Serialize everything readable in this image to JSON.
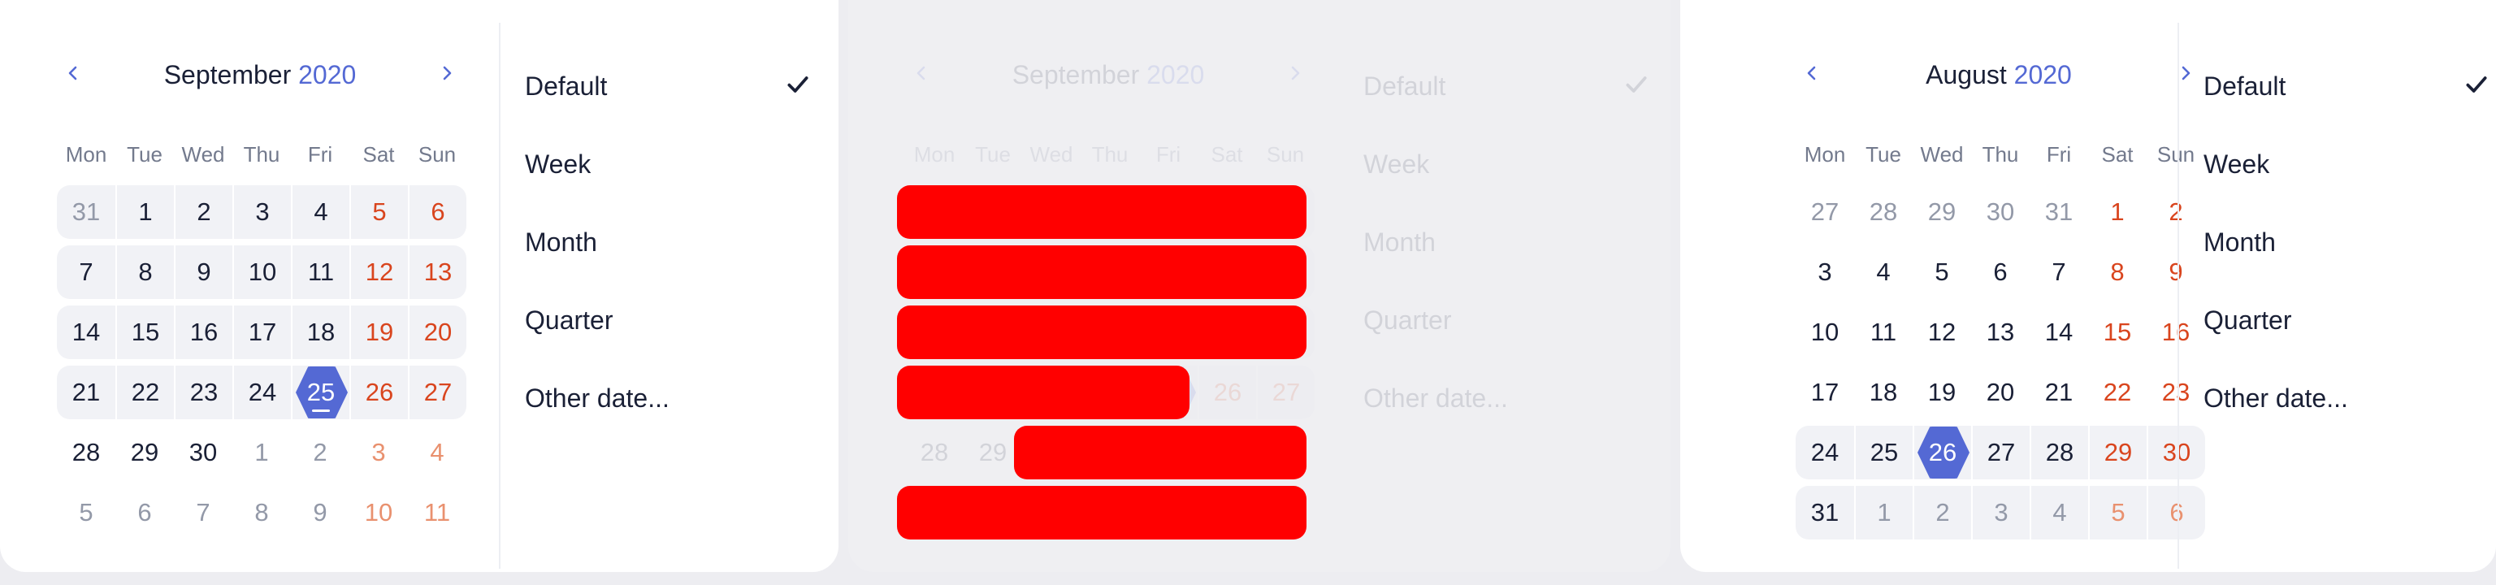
{
  "weekdays": [
    "Mon",
    "Tue",
    "Wed",
    "Thu",
    "Fri",
    "Sat",
    "Sun"
  ],
  "menu_items": [
    "Default",
    "Week",
    "Month",
    "Quarter",
    "Other date..."
  ],
  "checked_item": "Default",
  "icons": {
    "prev": "chevron-left-icon",
    "next": "chevron-right-icon",
    "check": "checkmark-icon"
  },
  "colors": {
    "accent": "#5469d4",
    "weekend": "#d9451e",
    "text": "#1a2036",
    "muted": "#9399a8",
    "highlight": "#f1f2f6",
    "error_overlay": "#ff0000"
  },
  "calendars": [
    {
      "month": "September",
      "year": "2020",
      "weeks": [
        [
          {
            "d": "31",
            "o": true
          },
          {
            "d": "1"
          },
          {
            "d": "2"
          },
          {
            "d": "3"
          },
          {
            "d": "4"
          },
          {
            "d": "5",
            "w": true
          },
          {
            "d": "6",
            "w": true
          }
        ],
        [
          {
            "d": "7"
          },
          {
            "d": "8"
          },
          {
            "d": "9"
          },
          {
            "d": "10"
          },
          {
            "d": "11"
          },
          {
            "d": "12",
            "w": true
          },
          {
            "d": "13",
            "w": true
          }
        ],
        [
          {
            "d": "14"
          },
          {
            "d": "15"
          },
          {
            "d": "16"
          },
          {
            "d": "17"
          },
          {
            "d": "18"
          },
          {
            "d": "19",
            "w": true
          },
          {
            "d": "20",
            "w": true
          }
        ],
        [
          {
            "d": "21"
          },
          {
            "d": "22"
          },
          {
            "d": "23"
          },
          {
            "d": "24"
          },
          {
            "d": "25",
            "s": true,
            "u": true
          },
          {
            "d": "26",
            "w": true
          },
          {
            "d": "27",
            "w": true
          }
        ],
        [
          {
            "d": "28"
          },
          {
            "d": "29"
          },
          {
            "d": "30"
          },
          {
            "d": "1",
            "o": true
          },
          {
            "d": "2",
            "o": true
          },
          {
            "d": "3",
            "o": true,
            "w": true
          },
          {
            "d": "4",
            "o": true,
            "w": true
          }
        ],
        [
          {
            "d": "5",
            "o": true
          },
          {
            "d": "6",
            "o": true
          },
          {
            "d": "7",
            "o": true
          },
          {
            "d": "8",
            "o": true
          },
          {
            "d": "9",
            "o": true
          },
          {
            "d": "10",
            "o": true,
            "w": true
          },
          {
            "d": "11",
            "o": true,
            "w": true
          }
        ]
      ],
      "highlighted_weeks": [
        0,
        1,
        2,
        3
      ]
    },
    {
      "month": "August",
      "year": "2020",
      "weeks": [
        [
          {
            "d": "27",
            "o": true
          },
          {
            "d": "28",
            "o": true
          },
          {
            "d": "29",
            "o": true
          },
          {
            "d": "30",
            "o": true
          },
          {
            "d": "31",
            "o": true
          },
          {
            "d": "1",
            "w": true
          },
          {
            "d": "2",
            "w": true
          }
        ],
        [
          {
            "d": "3"
          },
          {
            "d": "4"
          },
          {
            "d": "5"
          },
          {
            "d": "6"
          },
          {
            "d": "7"
          },
          {
            "d": "8",
            "w": true
          },
          {
            "d": "9",
            "w": true
          }
        ],
        [
          {
            "d": "10"
          },
          {
            "d": "11"
          },
          {
            "d": "12"
          },
          {
            "d": "13"
          },
          {
            "d": "14"
          },
          {
            "d": "15",
            "w": true
          },
          {
            "d": "16",
            "w": true
          }
        ],
        [
          {
            "d": "17"
          },
          {
            "d": "18"
          },
          {
            "d": "19"
          },
          {
            "d": "20"
          },
          {
            "d": "21"
          },
          {
            "d": "22",
            "w": true
          },
          {
            "d": "23",
            "w": true
          }
        ],
        [
          {
            "d": "24"
          },
          {
            "d": "25"
          },
          {
            "d": "26",
            "s": true
          },
          {
            "d": "27"
          },
          {
            "d": "28"
          },
          {
            "d": "29",
            "w": true
          },
          {
            "d": "30",
            "w": true
          }
        ],
        [
          {
            "d": "31"
          },
          {
            "d": "1",
            "o": true
          },
          {
            "d": "2",
            "o": true
          },
          {
            "d": "3",
            "o": true
          },
          {
            "d": "4",
            "o": true
          },
          {
            "d": "5",
            "o": true,
            "w": true
          },
          {
            "d": "6",
            "o": true,
            "w": true
          }
        ]
      ],
      "highlighted_weeks": [
        4,
        5
      ]
    }
  ]
}
